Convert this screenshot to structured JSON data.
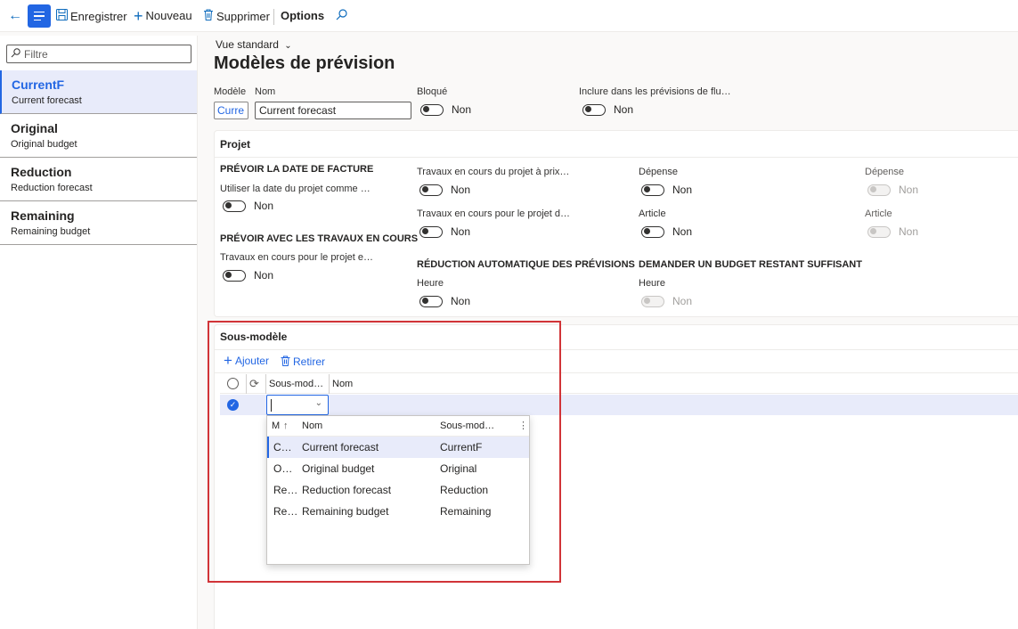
{
  "toolbar": {
    "save_label": "Enregistrer",
    "new_label": "Nouveau",
    "delete_label": "Supprimer",
    "options_label": "Options"
  },
  "nav": {
    "filter_placeholder": "Filtre",
    "items": [
      {
        "title": "CurrentF",
        "subtitle": "Current forecast"
      },
      {
        "title": "Original",
        "subtitle": "Original budget"
      },
      {
        "title": "Reduction",
        "subtitle": "Reduction forecast"
      },
      {
        "title": "Remaining",
        "subtitle": "Remaining budget"
      }
    ]
  },
  "header": {
    "view": "Vue standard",
    "title": "Modèles de prévision",
    "model_label": "Modèle",
    "model_value": "Curre",
    "name_label": "Nom",
    "name_value": "Current forecast",
    "blocked_label": "Bloqué",
    "blocked_value": "Non",
    "include_label": "Inclure dans les prévisions de flu…",
    "include_value": "Non"
  },
  "projet": {
    "title": "Projet",
    "group1_title": "PRÉVOIR LA DATE DE FACTURE",
    "g1_field_label": "Utiliser la date du projet comme …",
    "g1_field_value": "Non",
    "group2_title": "PRÉVOIR AVEC LES TRAVAUX EN COURS",
    "g2_field_label": "Travaux en cours pour le projet e…",
    "g2_field_value": "Non",
    "c2_f1_label": "Travaux en cours du projet à prix…",
    "c2_f1_value": "Non",
    "c2_f2_label": "Travaux en cours pour le projet d…",
    "c2_f2_value": "Non",
    "group3_title": "RÉDUCTION AUTOMATIQUE DES PRÉVISIONS",
    "g3_field_label": "Heure",
    "g3_field_value": "Non",
    "c3_f1_label": "Dépense",
    "c3_f1_value": "Non",
    "c3_f2_label": "Article",
    "c3_f2_value": "Non",
    "group4_title": "DEMANDER UN BUDGET RESTANT SUFFISANT",
    "g4_field_label": "Heure",
    "g4_field_value": "Non",
    "c4_f1_label": "Dépense",
    "c4_f1_value": "Non",
    "c4_f2_label": "Article",
    "c4_f2_value": "Non"
  },
  "submodel": {
    "title": "Sous-modèle",
    "add_label": "Ajouter",
    "remove_label": "Retirer",
    "col_submodel": "Sous-mod…",
    "col_name": "Nom"
  },
  "lookup": {
    "col_m": "M",
    "col_name": "Nom",
    "col_sub": "Sous-mod…",
    "rows": [
      {
        "m": "C…",
        "name": "Current forecast",
        "sub": "CurrentF"
      },
      {
        "m": "O…",
        "name": "Original budget",
        "sub": "Original"
      },
      {
        "m": "Re…",
        "name": "Reduction forecast",
        "sub": "Reduction"
      },
      {
        "m": "Re…",
        "name": "Remaining budget",
        "sub": "Remaining"
      }
    ]
  },
  "colors": {
    "accent": "#2266e3",
    "highlight": "#d13438"
  }
}
